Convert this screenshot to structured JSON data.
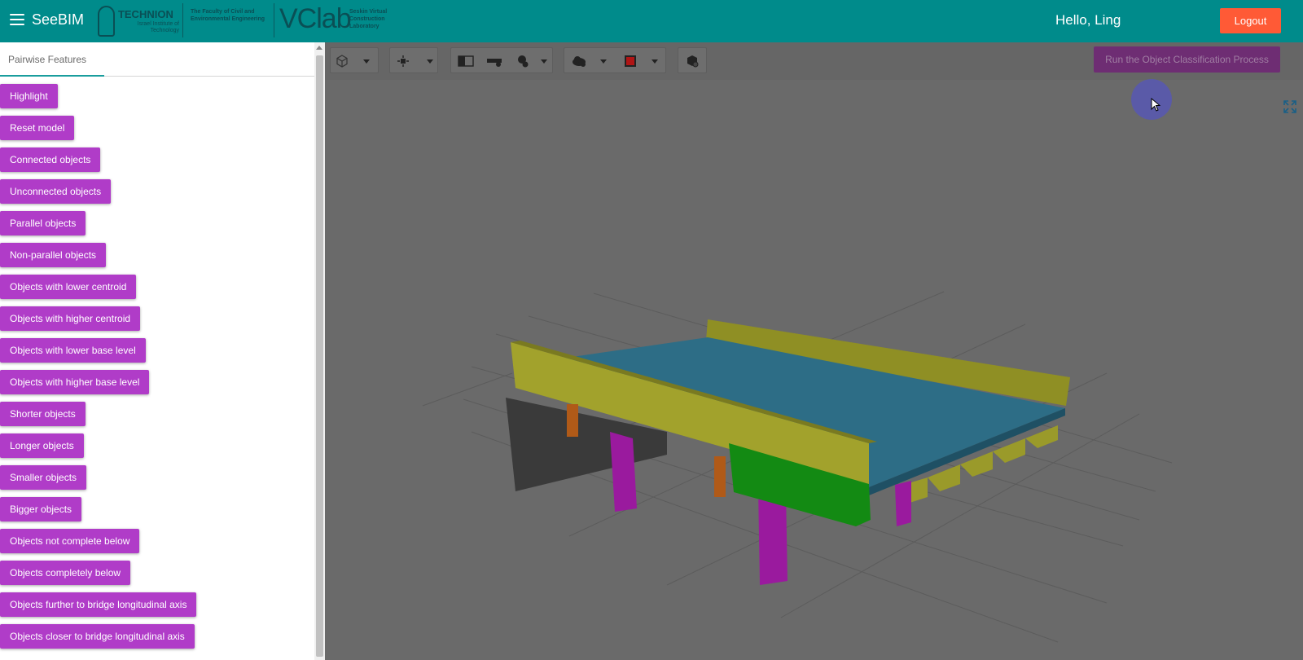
{
  "header": {
    "app_title": "SeeBIM",
    "technion_name": "TECHNION",
    "technion_sub": "Israel Institute of Technology",
    "faculty_text": "The Faculty of Civil and Environmental Engineering",
    "vclab_name": "VClab",
    "vclab_sub": "Seskin Virtual Construction Laboratory",
    "greeting": "Hello, Ling",
    "logout_label": "Logout",
    "bar_color": "#008b8b"
  },
  "sidebar": {
    "tab_label": "Pairwise Features",
    "buttons": [
      "Highlight",
      "Reset model",
      "Connected objects",
      "Unconnected objects",
      "Parallel objects",
      "Non-parallel objects",
      "Objects with lower centroid",
      "Objects with higher centroid",
      "Objects with lower base level",
      "Objects with higher base level",
      "Shorter objects",
      "Longer objects",
      "Smaller objects",
      "Bigger objects",
      "Objects not complete below",
      "Objects completely below",
      "Objects further to bridge longitudinal axis",
      "Objects closer to bridge longitudinal axis"
    ],
    "button_color": "#b03cc8"
  },
  "viewer": {
    "run_label": "Run the Object Classification Process",
    "toolbar_icons": [
      "cube-icon",
      "focus-icon",
      "split-view-icon",
      "measure-icon",
      "info-icon",
      "cloud-icon",
      "color-square-icon",
      "package-icon"
    ],
    "scene_colors": {
      "deck": "#2d6d86",
      "parapet": "#9a9a2a",
      "pier": "#9a1a9e",
      "beam": "#138a13",
      "bearing": "#b05a18",
      "abutment": "#3a3a3a"
    }
  }
}
